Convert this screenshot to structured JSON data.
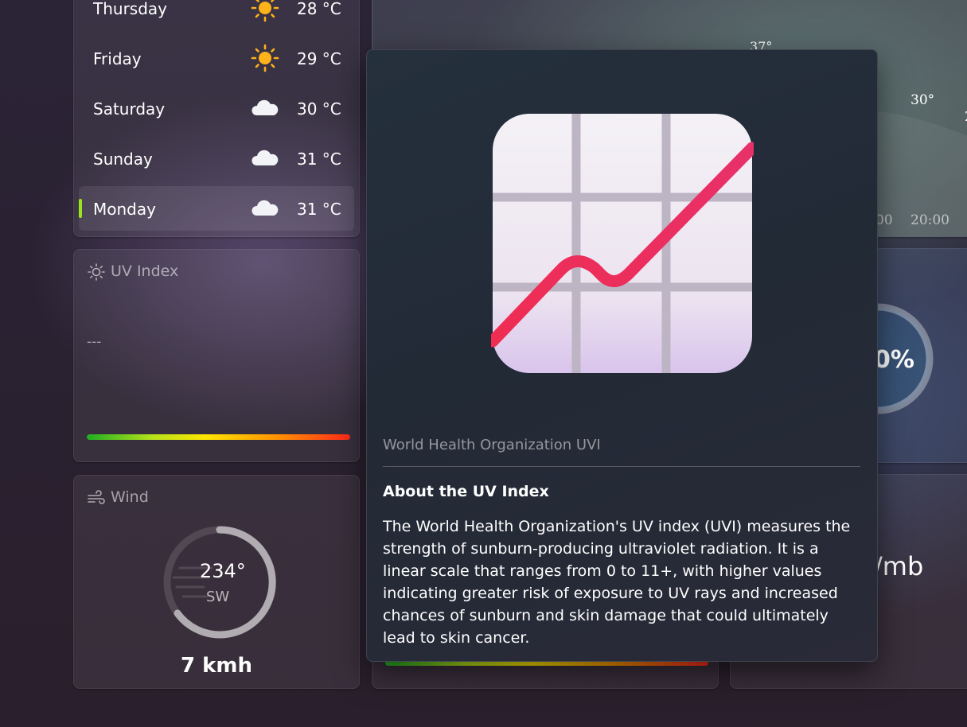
{
  "forecast": {
    "days": [
      {
        "name": "Thursday",
        "temp": "28 °C",
        "icon": "sun-icon"
      },
      {
        "name": "Friday",
        "temp": "29 °C",
        "icon": "sun-icon"
      },
      {
        "name": "Saturday",
        "temp": "30 °C",
        "icon": "cloud-icon"
      },
      {
        "name": "Sunday",
        "temp": "31 °C",
        "icon": "cloud-icon"
      },
      {
        "name": "Monday",
        "temp": "31 °C",
        "icon": "cloud-icon",
        "selected": true
      }
    ]
  },
  "uv_card": {
    "title": "UV Index",
    "value": "---"
  },
  "wind_card": {
    "title": "Wind",
    "degrees": "234°",
    "direction": "SW",
    "speed": "7 kmh"
  },
  "background_chart": {
    "labels": [
      "37°",
      "30°",
      "2"
    ],
    "time_labels": [
      "00",
      "20:00"
    ]
  },
  "background_humidity": {
    "percent_fragment": "0%"
  },
  "background_pressure": {
    "unit_fragment": "/mb"
  },
  "flyout": {
    "caption": "World Health Organization UVI",
    "heading": "About the UV Index",
    "body": "The World Health Organization's UV index (UVI) measures the strength of sunburn-producing ultraviolet radiation. It is a linear scale that ranges from 0 to 11+, with higher values indicating greater risk of exposure to UV rays and increased chances of sunburn and skin damage that could ultimately lead to skin cancer."
  },
  "colors": {
    "selected_indicator": "#9be51c",
    "sun": "#ffb21a",
    "chart_line": "#e8306a"
  }
}
